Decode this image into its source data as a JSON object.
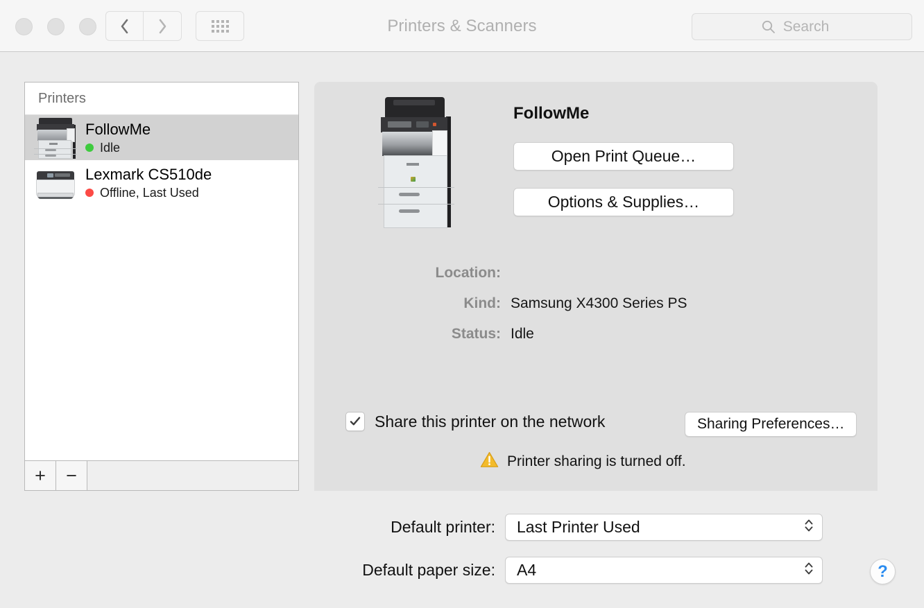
{
  "window": {
    "title": "Printers & Scanners",
    "traffic_lights": [
      "close",
      "minimize",
      "zoom"
    ],
    "nav": {
      "back_icon": "chevron-left-icon",
      "forward_icon": "chevron-right-icon",
      "grid_icon": "show-all-grid-icon"
    },
    "search": {
      "icon": "search-icon",
      "placeholder": "Search",
      "value": ""
    }
  },
  "sidebar": {
    "header": "Printers",
    "printers": [
      {
        "name": "FollowMe",
        "status": "Idle",
        "status_color": "#3ecb3e",
        "selected": true,
        "icon": "multifunction-printer-icon"
      },
      {
        "name": "Lexmark CS510de",
        "status": "Offline, Last Used",
        "status_color": "#fc4a45",
        "selected": false,
        "icon": "laser-printer-icon"
      }
    ],
    "toolbar": {
      "add_label": "+",
      "remove_label": "−"
    }
  },
  "detail": {
    "printer_image": "multifunction-printer-image",
    "title": "FollowMe",
    "open_print_queue_label": "Open Print Queue…",
    "options_supplies_label": "Options & Supplies…",
    "info": [
      {
        "label": "Location:",
        "value": ""
      },
      {
        "label": "Kind:",
        "value": "Samsung X4300 Series PS"
      },
      {
        "label": "Status:",
        "value": "Idle"
      }
    ],
    "sharing": {
      "checkbox_checked": true,
      "checkbox_glyph": "✓",
      "label": "Share this printer on the network",
      "button_label": "Sharing Preferences…",
      "warning_icon": "warning-triangle-icon",
      "warning_text": "Printer sharing is turned off."
    }
  },
  "footer": {
    "default_printer": {
      "label": "Default printer:",
      "value": "Last Printer Used",
      "chevron_icon": "chevron-updown-icon"
    },
    "default_paper_size": {
      "label": "Default paper size:",
      "value": "A4",
      "chevron_icon": "chevron-updown-icon"
    },
    "help": {
      "icon": "help-question-icon",
      "label": "?"
    }
  },
  "colors": {
    "window_background": "#ececec",
    "titlebar": "#f6f6f6",
    "detail_pane": "#e0e0e0",
    "selection": "#d2d2d2",
    "status_idle": "#3ecb3e",
    "status_offline": "#fc4a45",
    "warning": "#f0b223",
    "help_blue": "#2b8cf0"
  }
}
